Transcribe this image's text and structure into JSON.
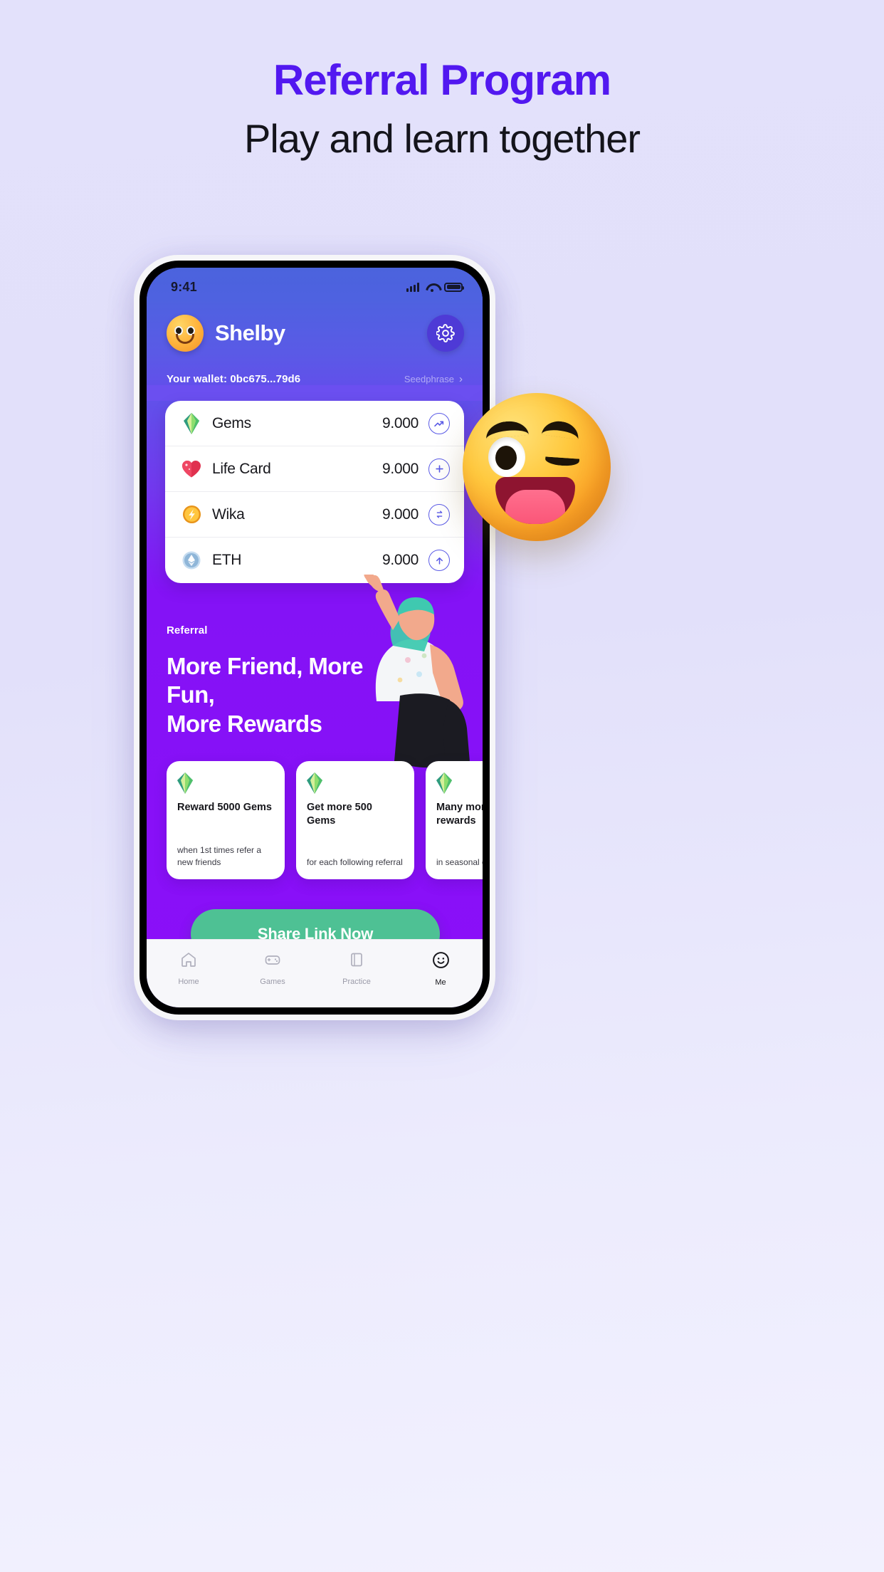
{
  "headline": {
    "title": "Referral Program",
    "subtitle": "Play and learn together",
    "title_color": "#5218f0"
  },
  "phone": {
    "status_bar": {
      "time": "9:41",
      "signal_icon": "cellular-signal-icon",
      "wifi_icon": "wifi-icon",
      "battery_icon": "battery-full-icon"
    },
    "header": {
      "avatar_icon": "smiley-avatar",
      "user_name": "Shelby",
      "settings_icon": "gear-icon",
      "wallet_label": "Your wallet: 0bc675...79d6",
      "seedphrase_label": "Seedphrase",
      "chevron_icon": "chevron-right-icon"
    },
    "assets": [
      {
        "icon": "gem-icon",
        "name": "Gems",
        "value": "9.000",
        "action_icon": "trending-up-icon"
      },
      {
        "icon": "heart-icon",
        "name": "Life Card",
        "value": "9.000",
        "action_icon": "plus-icon"
      },
      {
        "icon": "coin-icon",
        "name": "Wika",
        "value": "9.000",
        "action_icon": "swap-icon"
      },
      {
        "icon": "eth-icon",
        "name": "ETH",
        "value": "9.000",
        "action_icon": "arrow-up-icon"
      }
    ],
    "referral": {
      "label": "Referral",
      "heading_line1": "More Friend, More Fun,",
      "heading_line2": "More Rewards",
      "cards": [
        {
          "icon": "gem-icon",
          "title": "Reward 5000 Gems",
          "subtitle": "when 1st times refer a new friends"
        },
        {
          "icon": "gem-icon",
          "title": "Get more 500 Gems",
          "subtitle": "for each following referral"
        },
        {
          "icon": "gem-icon",
          "title": "Many more rewards",
          "subtitle": "in seasonal campaigns"
        }
      ],
      "share_button": "Share Link Now",
      "share_button_color": "#4ec194"
    },
    "bottom_nav": [
      {
        "icon": "home-icon",
        "label": "Home",
        "active": false
      },
      {
        "icon": "gamepad-icon",
        "label": "Games",
        "active": false
      },
      {
        "icon": "book-icon",
        "label": "Practice",
        "active": false
      },
      {
        "icon": "smiley-icon",
        "label": "Me",
        "active": true
      }
    ]
  },
  "decoration": {
    "emoji": "winking-face-with-tongue-3d"
  }
}
